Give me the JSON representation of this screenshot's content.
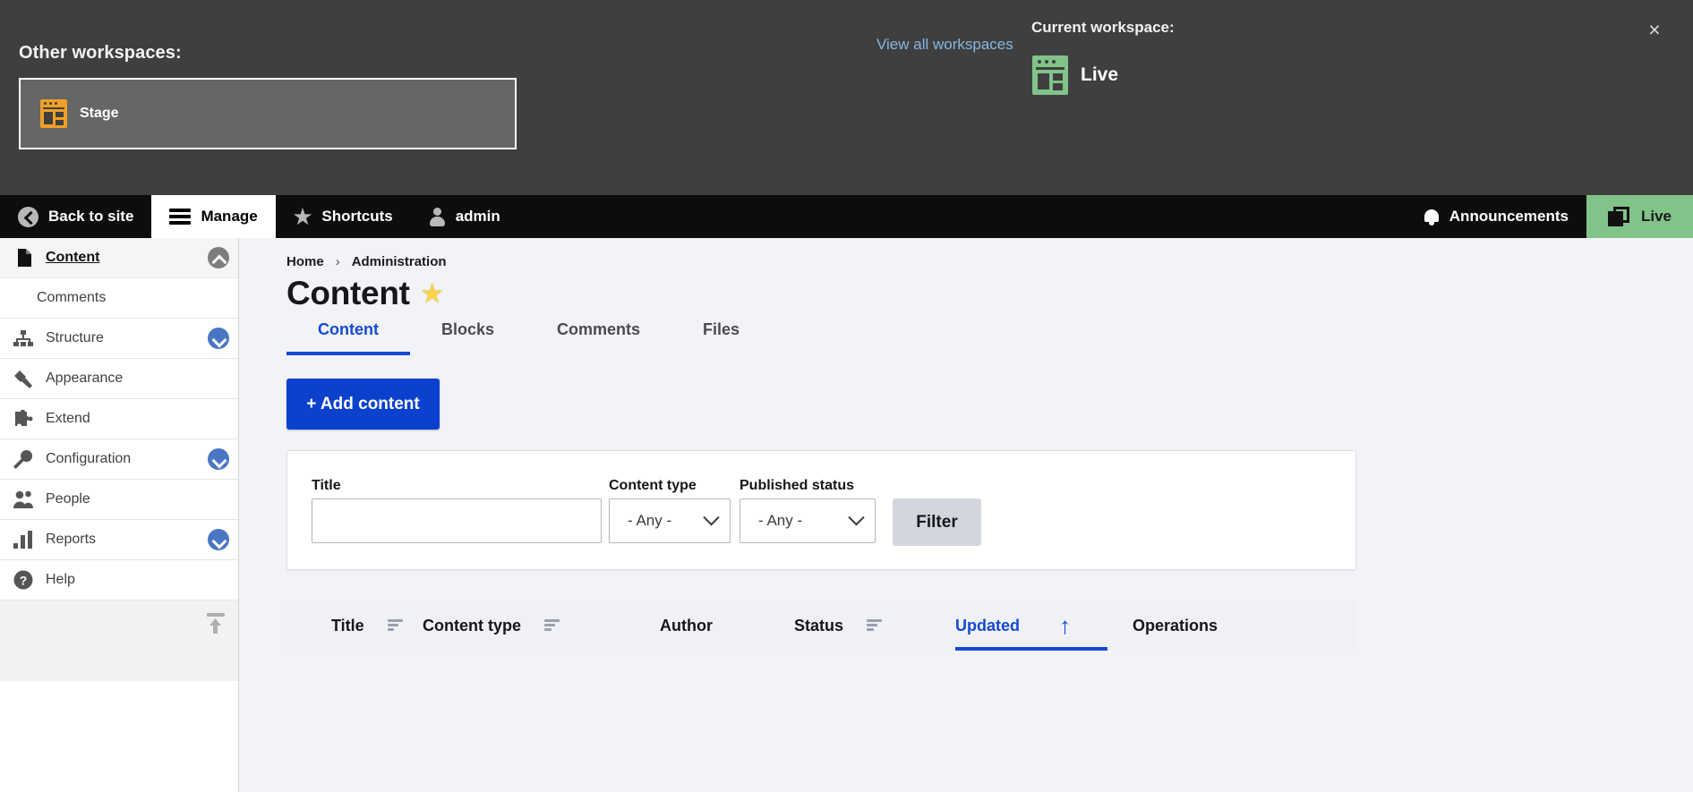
{
  "workspace_panel": {
    "close_label": "×",
    "other_label": "Other workspaces:",
    "other_items": [
      {
        "name": "Stage",
        "icon": "workspace-window-icon",
        "color": "#f0a026"
      }
    ],
    "view_all_label": "View all workspaces",
    "current_label": "Current workspace:",
    "current": {
      "name": "Live",
      "icon": "workspace-window-icon",
      "color": "#82c38a"
    }
  },
  "toolbar": {
    "items": [
      {
        "label": "Back to site",
        "icon": "back-arrow-circle-icon",
        "active": false
      },
      {
        "label": "Manage",
        "icon": "hamburger-icon",
        "active": true
      },
      {
        "label": "Shortcuts",
        "icon": "star-icon",
        "active": false
      },
      {
        "label": "admin",
        "icon": "user-icon",
        "active": false
      }
    ],
    "announcements_label": "Announcements",
    "announcements_icon": "bell-icon",
    "live_label": "Live",
    "live_icon": "window-stack-icon",
    "live_color": "#82c38a"
  },
  "sidebar": {
    "items": [
      {
        "label": "Content",
        "icon": "page-icon",
        "active": true,
        "chevron": "up",
        "chevron_color": "gray"
      },
      {
        "label": "Comments",
        "icon": "",
        "sub": true
      },
      {
        "label": "Structure",
        "icon": "structure-icon",
        "chevron": "down",
        "chevron_color": "blue"
      },
      {
        "label": "Appearance",
        "icon": "paintbrush-icon"
      },
      {
        "label": "Extend",
        "icon": "puzzle-icon"
      },
      {
        "label": "Configuration",
        "icon": "wrench-icon",
        "chevron": "down",
        "chevron_color": "blue"
      },
      {
        "label": "People",
        "icon": "people-icon"
      },
      {
        "label": "Reports",
        "icon": "bar-chart-icon",
        "chevron": "down",
        "chevron_color": "blue"
      },
      {
        "label": "Help",
        "icon": "question-circle-icon"
      }
    ],
    "collapse_icon": "collapse-up-icon"
  },
  "main": {
    "breadcrumb": [
      "Home",
      "Administration"
    ],
    "breadcrumb_separator": "›",
    "page_title": "Content",
    "title_star": "★",
    "tabs": [
      {
        "label": "Content",
        "active": true
      },
      {
        "label": "Blocks",
        "active": false
      },
      {
        "label": "Comments",
        "active": false
      },
      {
        "label": "Files",
        "active": false
      }
    ],
    "add_content_label": "+ Add content",
    "filters": {
      "title_label": "Title",
      "title_value": "",
      "title_placeholder": "",
      "content_type_label": "Content type",
      "content_type_value": "- Any -",
      "published_status_label": "Published status",
      "published_status_value": "- Any -",
      "submit_label": "Filter"
    },
    "table": {
      "columns": [
        {
          "label": "Title",
          "sortable": true,
          "sorted": false
        },
        {
          "label": "Content type",
          "sortable": true,
          "sorted": false
        },
        {
          "label": "Author",
          "sortable": false,
          "sorted": false
        },
        {
          "label": "Status",
          "sortable": true,
          "sorted": false
        },
        {
          "label": "Updated",
          "sortable": true,
          "sorted": true,
          "sort_direction": "↑"
        },
        {
          "label": "Operations",
          "sortable": false,
          "sorted": false
        }
      ],
      "rows": []
    }
  },
  "colors": {
    "accent_blue": "#1449d4",
    "button_blue": "#0b41cd",
    "live_green": "#82c38a",
    "stage_orange": "#f0a026",
    "panel_dark": "#3f3f3f",
    "toolbar_black": "#0d0d0d"
  }
}
